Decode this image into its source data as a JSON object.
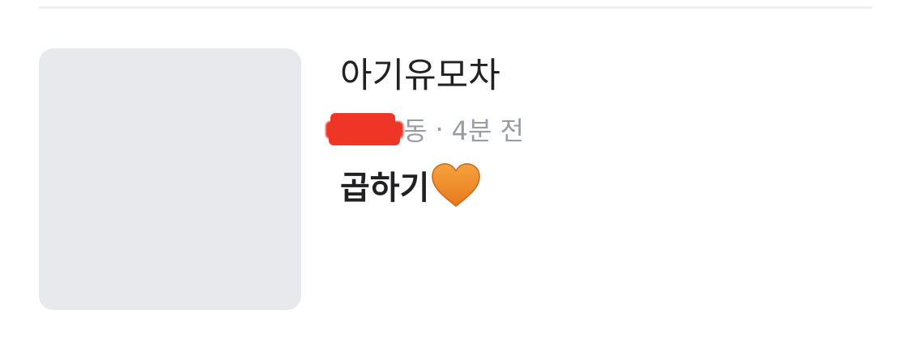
{
  "post": {
    "title": "아기유모차",
    "location_suffix": "동",
    "separator": "·",
    "time_ago": "4분 전",
    "status_text": "곱하기",
    "status_emoji": "orange-heart-icon"
  },
  "colors": {
    "text": "#212124",
    "meta": "#9a9ca3",
    "thumbnail_bg": "#e8e9ec",
    "redaction": "#ee3526",
    "heart": "#f5902b"
  }
}
